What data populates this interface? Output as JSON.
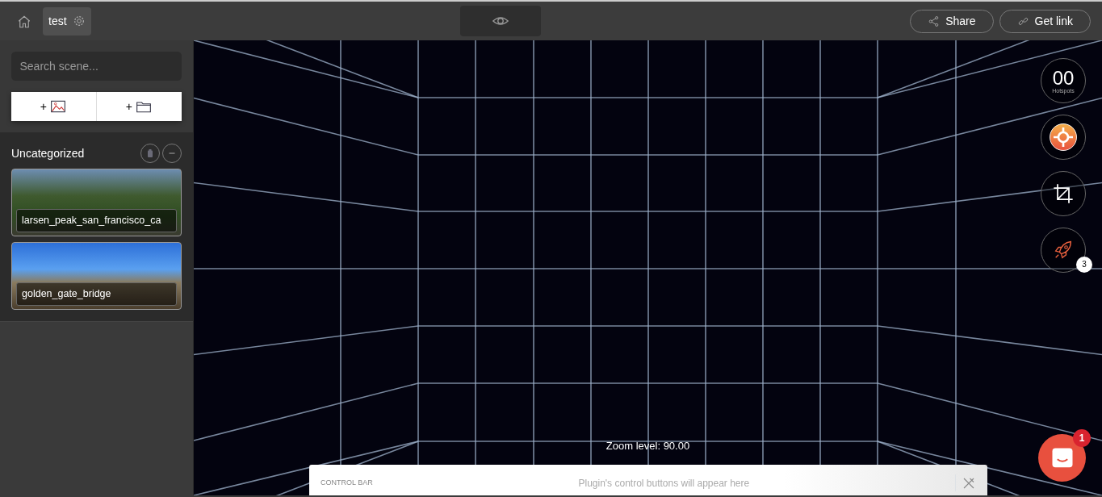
{
  "topbar": {
    "project": {
      "name": "test"
    },
    "buttons": [
      {
        "kind": "share",
        "label": "Share"
      },
      {
        "kind": "link",
        "label": "Get link"
      }
    ]
  },
  "sidebar": {
    "search": {
      "placeholder": "Search scene..."
    },
    "add_buttons": [
      {
        "kind": "image",
        "label": "+"
      },
      {
        "kind": "folder",
        "label": "+"
      }
    ],
    "category": {
      "title": "Uncategorized",
      "scenes": [
        {
          "name": "larsen_peak_san_francisco_ca",
          "kind": "forest"
        },
        {
          "name": "golden_gate_bridge",
          "kind": "bridge"
        }
      ]
    }
  },
  "viewer": {
    "hotspots": {
      "count": "00",
      "label": "Hotspots"
    },
    "tools": [
      {
        "kind": "target"
      },
      {
        "kind": "crop"
      },
      {
        "kind": "rocket",
        "badge": "3"
      }
    ],
    "zoom_text": "Zoom level: 90.00",
    "control_bar": {
      "label": "CONTROL BAR",
      "message": "Plugin's control buttons will appear here"
    },
    "chat": {
      "badge": "1"
    }
  }
}
